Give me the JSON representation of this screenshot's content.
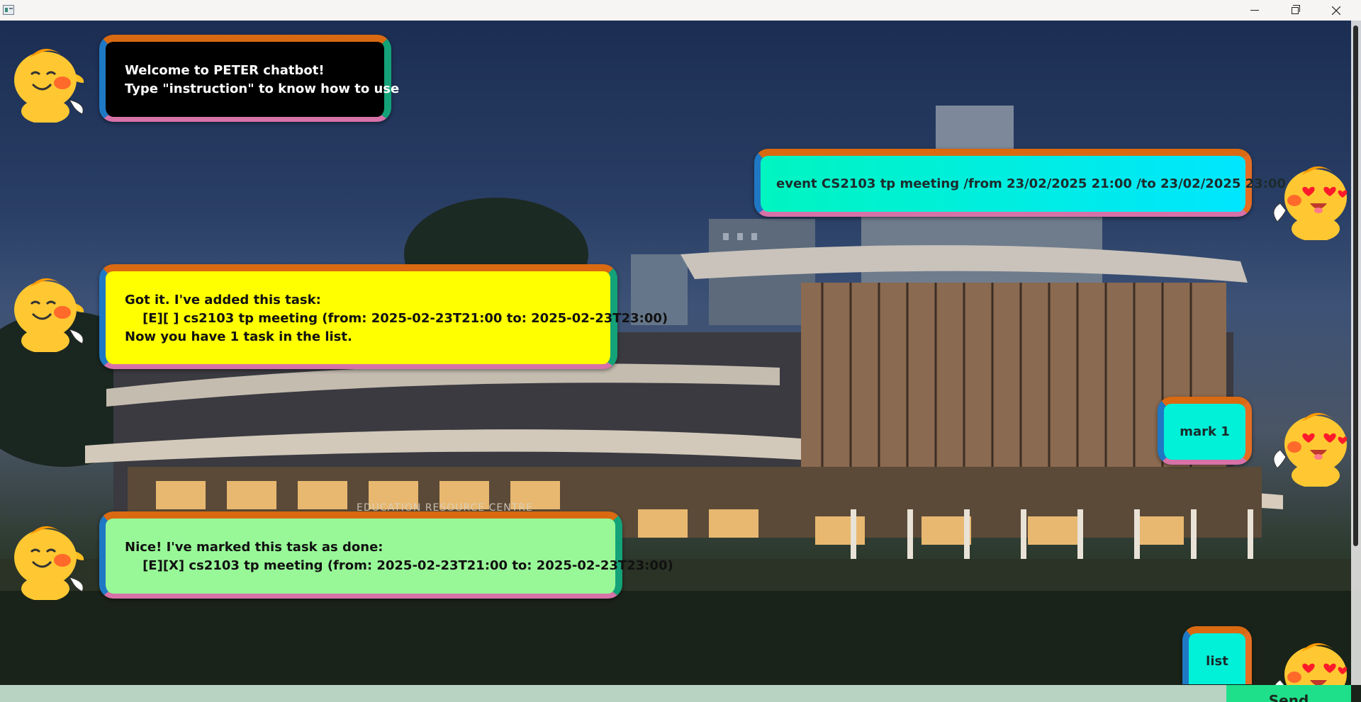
{
  "window": {
    "title": "",
    "controls": [
      "minimize",
      "maximize",
      "close"
    ]
  },
  "conversation": [
    {
      "sender": "bot",
      "text": "Welcome to PETER chatbot!\nType \"instruction\" to know how to use"
    },
    {
      "sender": "user",
      "text": "event CS2103 tp meeting /from 23/02/2025 21:00 /to 23/02/2025 23:00"
    },
    {
      "sender": "bot",
      "text": "Got it. I've added this task:\n    [E][ ] cs2103 tp meeting (from: 2025-02-23T21:00 to: 2025-02-23T23:00)\nNow you have 1 task in the list."
    },
    {
      "sender": "user",
      "text": "mark 1"
    },
    {
      "sender": "bot",
      "text": "Nice! I've marked this task as done:\n    [E][X] cs2103 tp meeting (from: 2025-02-23T21:00 to: 2025-02-23T23:00)"
    },
    {
      "sender": "user",
      "text": "list"
    }
  ],
  "background_sign": "EDUCATION RESOURCE CENTRE",
  "input": {
    "value": "",
    "placeholder": ""
  },
  "send_button": {
    "label": "Send"
  },
  "icons": {
    "bot_avatar": "smiling-mascot-icon",
    "user_avatar": "heart-eyes-mascot-icon"
  },
  "colors": {
    "bubble_border_top": "#d96a12",
    "bubble_border_right": "#14a278",
    "bubble_border_bottom": "#d672a8",
    "bubble_border_left": "#1f78c4",
    "welcome_bg": "#000000",
    "added_bg": "#ffff00",
    "marked_bg": "#98f898",
    "user_bg": "#00f0d8",
    "input_bg": "#b9d3c3",
    "send_bg": "#1fe08a"
  }
}
